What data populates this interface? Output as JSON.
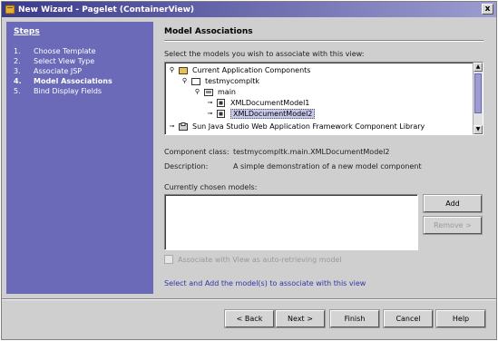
{
  "window": {
    "title": "New Wizard - Pagelet (ContainerView)",
    "close_label": "x"
  },
  "steps": {
    "title": "Steps",
    "items": [
      {
        "num": "1.",
        "label": "Choose Template"
      },
      {
        "num": "2.",
        "label": "Select View Type"
      },
      {
        "num": "3.",
        "label": "Associate JSP"
      },
      {
        "num": "4.",
        "label": "Model Associations",
        "current": true
      },
      {
        "num": "5.",
        "label": "Bind Display Fields"
      }
    ]
  },
  "content": {
    "heading": "Model Associations",
    "select_prompt": "Select the models you wish to associate with this view:",
    "tree": [
      {
        "label": "Current Application Components"
      },
      {
        "label": "testmycompltk"
      },
      {
        "label": "main"
      },
      {
        "label": "XMLDocumentModel1"
      },
      {
        "label": "XMLDocumentModel2",
        "selected": true
      },
      {
        "label": "Sun Java Studio Web Application Framework Component Library"
      }
    ],
    "component_class_label": "Component class:",
    "component_class_value": "testmycompltk.main.XMLDocumentModel2",
    "description_label": "Description:",
    "description_value": "A simple demonstration of a new model component",
    "chosen_label": "Currently chosen models:",
    "add_button": "Add",
    "remove_button": "Remove >",
    "checkbox_label": "Associate with View as auto-retrieving model",
    "hint_link": "Select and Add the model(s) to associate with this view"
  },
  "footer": {
    "back": "< Back",
    "next": "Next >",
    "finish": "Finish",
    "cancel": "Cancel",
    "help": "Help"
  }
}
